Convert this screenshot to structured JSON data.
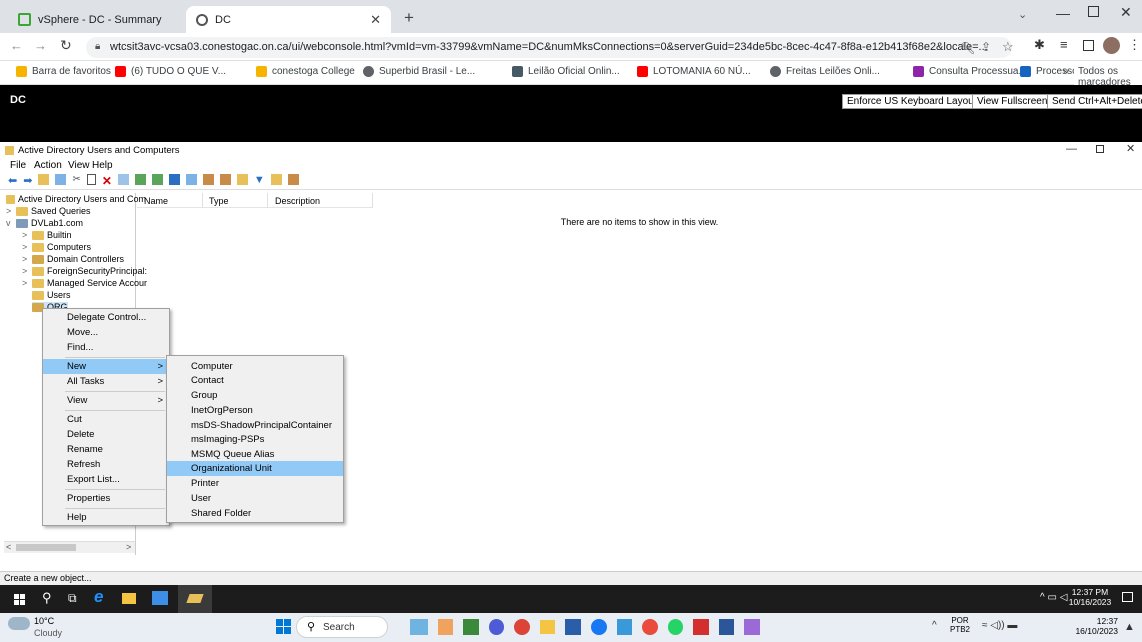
{
  "browser": {
    "tabs": [
      {
        "label": "vSphere - DC - Summary",
        "active": false
      },
      {
        "label": "DC",
        "active": true
      }
    ],
    "url": "wtcsit3avc-vcsa03.conestogac.on.ca/ui/webconsole.html?vmId=vm-33799&vmName=DC&numMksConnections=0&serverGuid=234de5bc-8cec-4c47-8f8a-e12b413f68e2&locale=...",
    "bookmarks": [
      {
        "label": "Barra de favoritos",
        "color": "#f4b400"
      },
      {
        "label": "(6) TUDO O QUE V...",
        "color": "#ff0000"
      },
      {
        "label": "conestoga College",
        "color": "#f4b400"
      },
      {
        "label": "Superbid Brasil - Le...",
        "color": "#5f6368"
      },
      {
        "label": "Leilão Oficial Onlin...",
        "color": "#455a64"
      },
      {
        "label": "LOTOMANIA 60 NÚ...",
        "color": "#ff0000"
      },
      {
        "label": "Freitas Leilões Onli...",
        "color": "#5f6368"
      },
      {
        "label": "Consulta Processua...",
        "color": "#8e24aa"
      },
      {
        "label": "Processo Nº CartPr...",
        "color": "#1565c0"
      }
    ],
    "bookmarks_more": "»",
    "all_bookmarks": "Todos os marcadores"
  },
  "vm": {
    "name": "DC",
    "buttons": [
      "Enforce US Keyboard Layout",
      "View Fullscreen",
      "Send Ctrl+Alt+Delete"
    ]
  },
  "mmc": {
    "title": "Active Directory Users and Computers",
    "menu": [
      "File",
      "Action",
      "View",
      "Help"
    ],
    "columns": [
      "Name",
      "Type",
      "Description"
    ],
    "empty_message": "There are no items to show in this view.",
    "status": "Create a new object...",
    "tree": [
      {
        "label": "Active Directory Users and Com",
        "expander": ""
      },
      {
        "label": "Saved Queries",
        "expander": ">"
      },
      {
        "label": "DVLab1.com",
        "expander": "v"
      },
      {
        "label": "Builtin",
        "expander": ">"
      },
      {
        "label": "Computers",
        "expander": ">"
      },
      {
        "label": "Domain Controllers",
        "expander": ">"
      },
      {
        "label": "ForeignSecurityPrincipal:",
        "expander": ">"
      },
      {
        "label": "Managed Service Accour",
        "expander": ">"
      },
      {
        "label": "Users",
        "expander": ""
      },
      {
        "label": "ORG",
        "expander": ""
      }
    ],
    "context_menu": [
      {
        "label": "Delegate Control...",
        "arrow": ""
      },
      {
        "label": "Move...",
        "arrow": ""
      },
      {
        "label": "Find...",
        "arrow": ""
      },
      {
        "label": "New",
        "arrow": ">"
      },
      {
        "label": "All Tasks",
        "arrow": ">"
      },
      {
        "label": "View",
        "arrow": ">"
      },
      {
        "label": "Cut",
        "arrow": ""
      },
      {
        "label": "Delete",
        "arrow": ""
      },
      {
        "label": "Rename",
        "arrow": ""
      },
      {
        "label": "Refresh",
        "arrow": ""
      },
      {
        "label": "Export List...",
        "arrow": ""
      },
      {
        "label": "Properties",
        "arrow": ""
      },
      {
        "label": "Help",
        "arrow": ""
      }
    ],
    "new_submenu": [
      "Computer",
      "Contact",
      "Group",
      "InetOrgPerson",
      "msDS-ShadowPrincipalContainer",
      "msImaging-PSPs",
      "MSMQ Queue Alias",
      "Organizational Unit",
      "Printer",
      "User",
      "Shared Folder"
    ],
    "highlighted_new_item": "Organizational Unit"
  },
  "vm_taskbar": {
    "time": "12:37 PM",
    "date": "10/16/2023"
  },
  "host_taskbar": {
    "weather_temp": "10°C",
    "weather_desc": "Cloudy",
    "search_label": "Search",
    "lang_top": "POR",
    "lang_bottom": "PTB2",
    "time": "12:37",
    "date": "16/10/2023"
  }
}
